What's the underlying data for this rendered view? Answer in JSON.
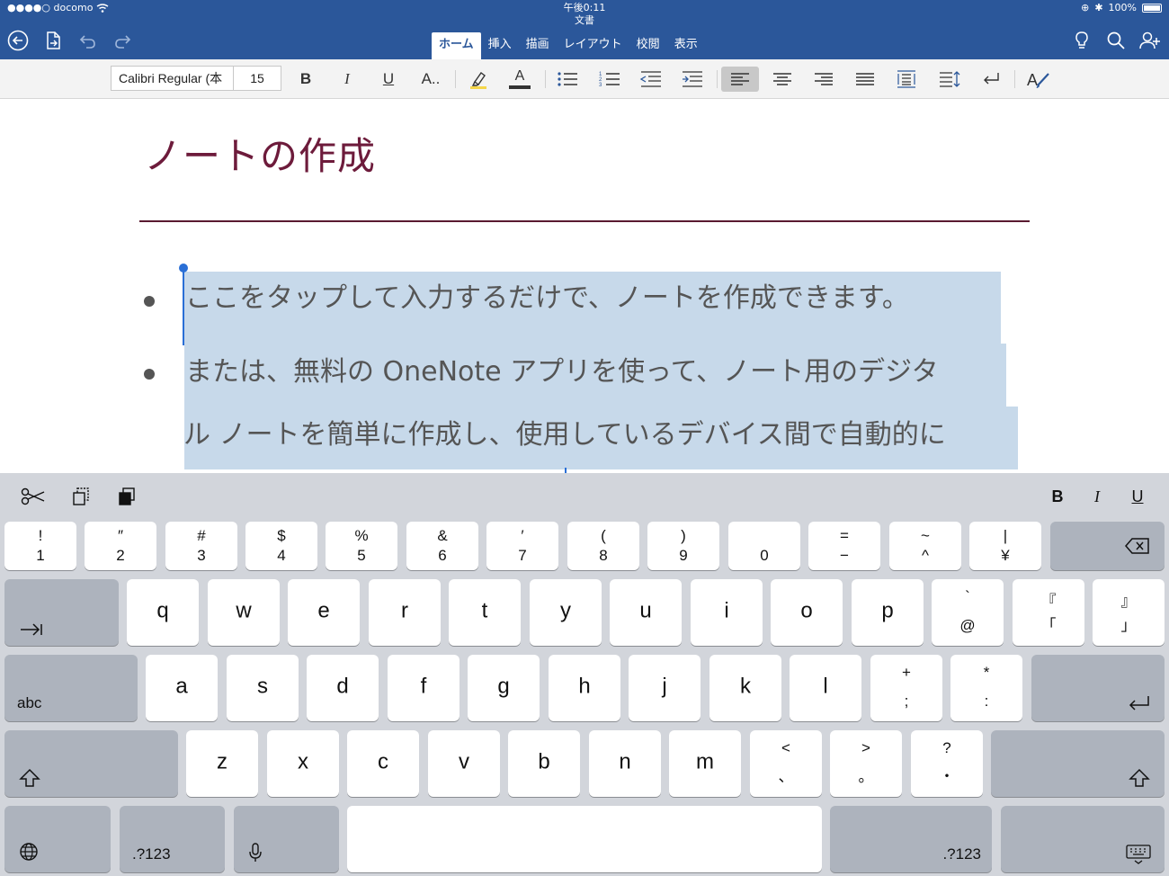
{
  "status": {
    "carrier": "●●●●○ docomo",
    "time": "午後0:11",
    "document_name": "文書",
    "battery": "100%"
  },
  "tabs": [
    {
      "label": "ホーム",
      "active": true
    },
    {
      "label": "挿入"
    },
    {
      "label": "描画"
    },
    {
      "label": "レイアウト"
    },
    {
      "label": "校閲"
    },
    {
      "label": "表示"
    }
  ],
  "ribbon": {
    "font_name": "Calibri Regular (本",
    "font_size": "15",
    "bold": "B",
    "italic": "I",
    "underline": "U",
    "font_more": "A..",
    "font_color": "A"
  },
  "document": {
    "title": "ノートの作成",
    "line1": "ここをタップして入力するだけで、ノートを作成できます。",
    "line2": "または、無料の OneNote アプリを使って、ノート用のデジタ",
    "line3": "ル ノートを簡単に作成し、使用しているデバイス間で自動的に"
  },
  "keyboard": {
    "shortcut_bold": "B",
    "shortcut_italic": "I",
    "shortcut_underline": "U",
    "number_row": [
      {
        "top": "!",
        "bot": "1"
      },
      {
        "top": "″",
        "bot": "2"
      },
      {
        "top": "#",
        "bot": "3"
      },
      {
        "top": "$",
        "bot": "4"
      },
      {
        "top": "%",
        "bot": "5"
      },
      {
        "top": "&",
        "bot": "6"
      },
      {
        "top": "′",
        "bot": "7"
      },
      {
        "top": "(",
        "bot": "8"
      },
      {
        "top": ")",
        "bot": "9"
      },
      {
        "top": "",
        "bot": "0"
      },
      {
        "top": "=",
        "bot": "−"
      },
      {
        "top": "~",
        "bot": "^"
      },
      {
        "top": "|",
        "bot": "¥"
      }
    ],
    "row_q": [
      "q",
      "w",
      "e",
      "r",
      "t",
      "y",
      "u",
      "i",
      "o",
      "p"
    ],
    "row_q_extra": [
      {
        "top": "`",
        "bot": "@"
      },
      {
        "top": "『",
        "bot": "「"
      },
      {
        "top": "』",
        "bot": "」"
      }
    ],
    "row_a": [
      "a",
      "s",
      "d",
      "f",
      "g",
      "h",
      "j",
      "k",
      "l"
    ],
    "row_a_extra": [
      {
        "top": "+",
        "bot": ";"
      },
      {
        "top": "*",
        "bot": ":"
      }
    ],
    "row_z": [
      "z",
      "x",
      "c",
      "v",
      "b",
      "n",
      "m"
    ],
    "row_z_extra": [
      {
        "top": "<",
        "bot": "、"
      },
      {
        "top": ">",
        "bot": "。"
      },
      {
        "top": "?",
        "bot": "・"
      }
    ],
    "abc_label": "abc",
    "num_label": ".?123"
  },
  "colors": {
    "brand": "#2b579a",
    "title": "#6d1b3b",
    "selection": "#c7d9ea",
    "caret": "#2a6fd6"
  }
}
